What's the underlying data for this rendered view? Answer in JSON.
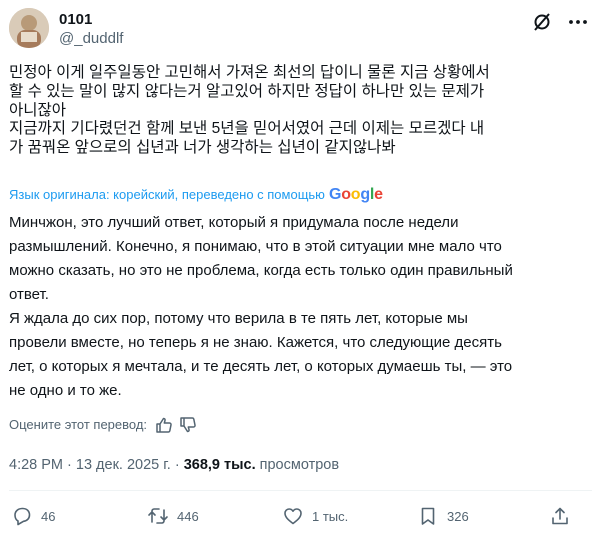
{
  "author": {
    "display_name": "0101",
    "handle": "@_duddlf"
  },
  "tweet": {
    "original_text": "민정아 이게 일주일동안 고민해서 가져온 최선의 답이니 물론 지금 상황에서\n할 수 있는 말이 많지 않다는거 알고있어 하지만 정답이 하나만 있는 문제가\n아니잖아\n지금까지 기다렸던건 함께 보낸 5년을 믿어서였어 근데 이제는 모르겠다 내\n가 꿈꿔온 앞으로의 십년과 너가 생각하는 십년이 같지않나봐",
    "translation_note": "Язык оригинала: корейский, переведено с помощью",
    "translation_provider": "Google",
    "translated_text": "Минчжон, это лучший ответ, который я придумала после недели\nразмышлений. Конечно, я понимаю, что в этой ситуации мне мало что\nможно сказать, но это не проблема, когда есть только один правильный\nответ.\nЯ ждала до сих пор, потому что верила в те пять лет, которые мы\nпровели вместе, но теперь я не знаю. Кажется, что следующие десять\nлет, о которых я мечтала, и те десять лет, о которых думаешь ты, — это\nне одно и то же.",
    "rate_label": "Оцените этот перевод:",
    "time": "4:28 PM",
    "date": "13 дек. 2025 г.",
    "separator": " · ",
    "views_count": "368,9 тыс.",
    "views_label": "просмотров"
  },
  "actions": {
    "replies": "46",
    "reposts": "446",
    "likes": "1 тыс.",
    "bookmarks": "326"
  },
  "icons": {
    "grok": "grok-icon",
    "more": "more-icon",
    "reply": "reply-icon",
    "repost": "repost-icon",
    "like": "heart-icon",
    "bookmark": "bookmark-icon",
    "share": "share-icon",
    "thumb_up": "thumbs-up-icon",
    "thumb_down": "thumbs-down-icon"
  },
  "colors": {
    "text": "#0f1419",
    "secondary": "#536471",
    "link": "#1d9bf0",
    "divider": "#eff3f4"
  }
}
